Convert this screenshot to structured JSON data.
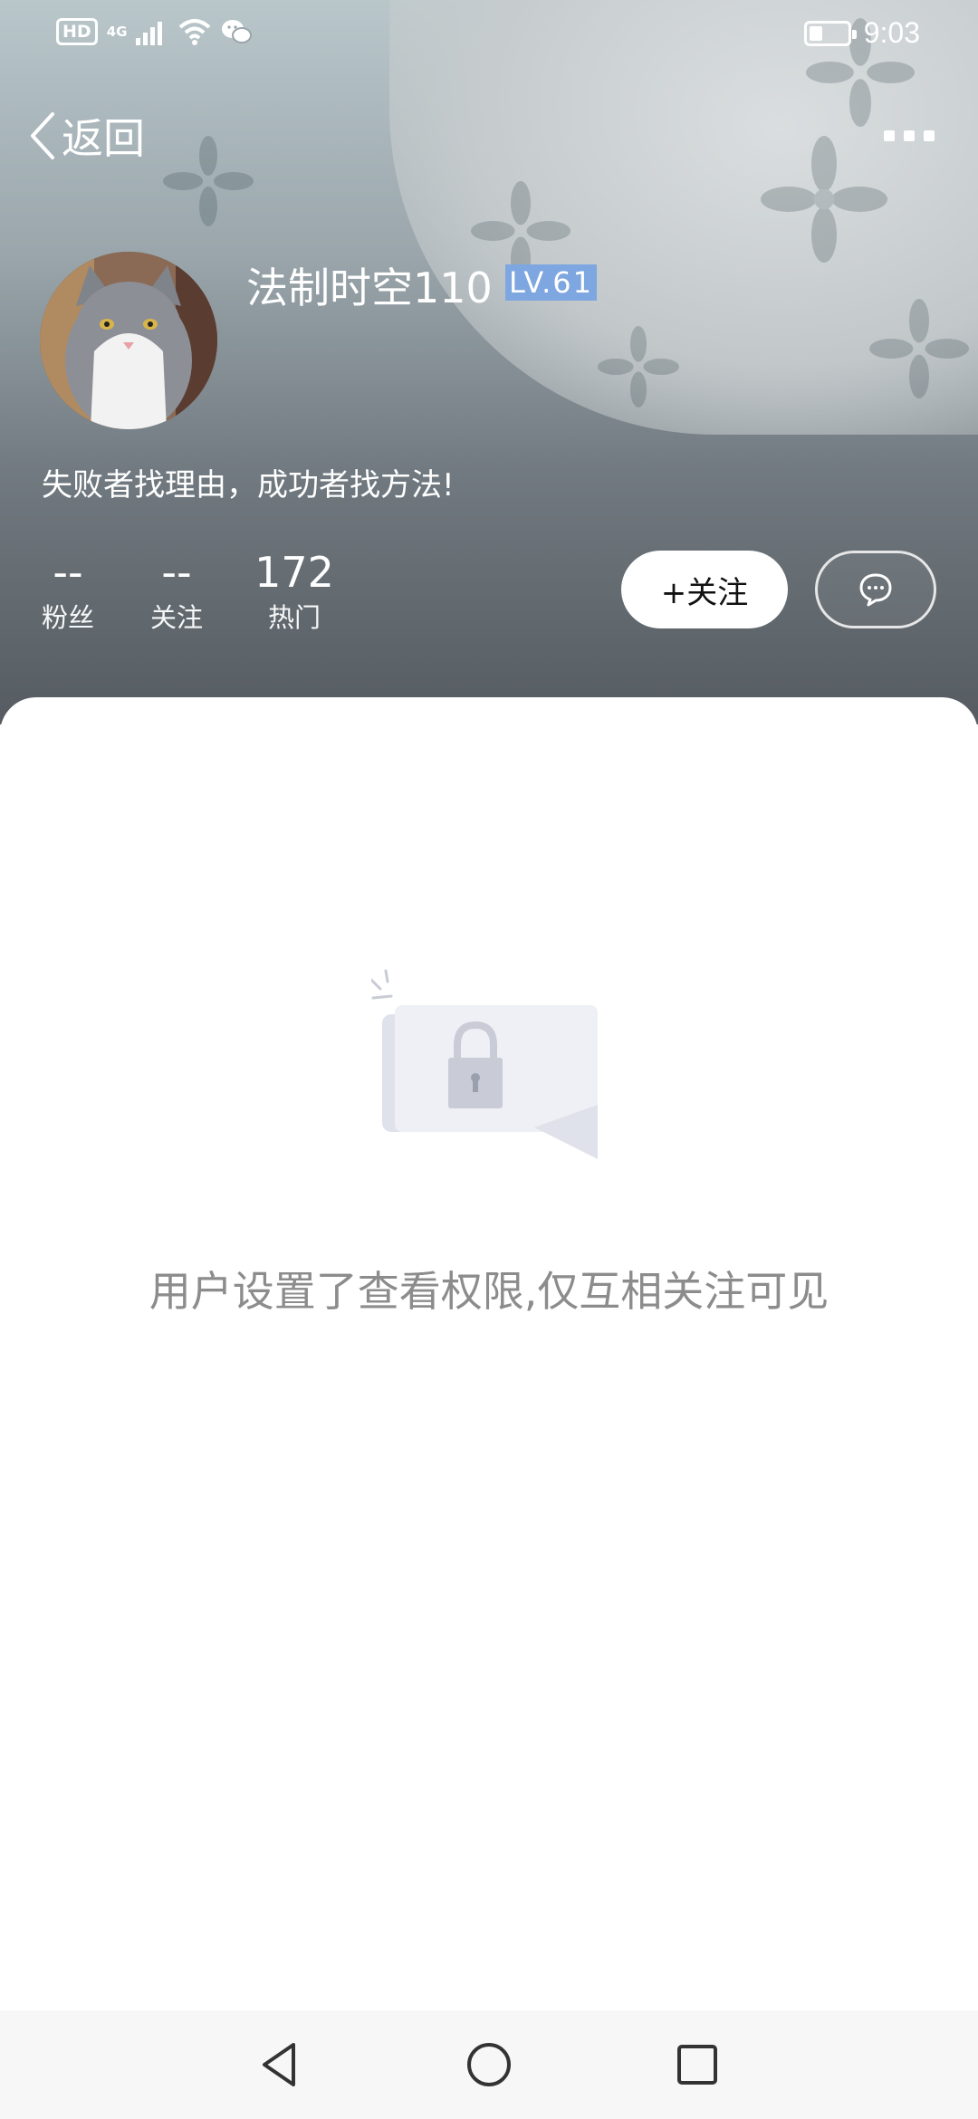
{
  "status_bar": {
    "hd_label": "HD",
    "network_label": "4G",
    "time": "9:03",
    "battery_percent": 35
  },
  "nav": {
    "back_label": "返回",
    "more_icon": "more-icon"
  },
  "profile": {
    "username": "法制时空110",
    "level": "LV.61",
    "bio": "失败者找理由，成功者找方法!",
    "stats": [
      {
        "value": "--",
        "label": "粉丝"
      },
      {
        "value": "--",
        "label": "关注"
      },
      {
        "value": "172",
        "label": "热门"
      }
    ],
    "follow_label": "+关注",
    "chat_icon": "chat-bubble-icon"
  },
  "content": {
    "empty_message": "用户设置了查看权限,仅互相关注可见",
    "illustration_icon": "lock-icon"
  },
  "system_nav": {
    "back_icon": "triangle-back-icon",
    "home_icon": "circle-home-icon",
    "recents_icon": "square-recents-icon"
  },
  "colors": {
    "level_badge_bg": "#7ea6e0",
    "empty_text": "#8c8c8c",
    "card_bg": "#ffffff"
  }
}
